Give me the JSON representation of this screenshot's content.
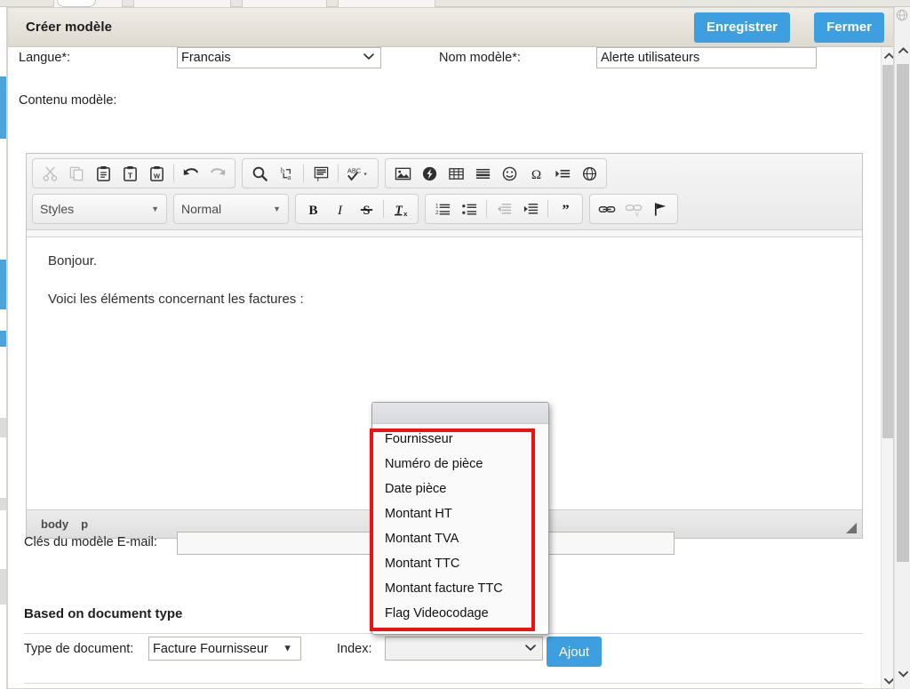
{
  "dialog": {
    "title": "Créer modèle",
    "save_label": "Enregistrer",
    "close_label": "Fermer"
  },
  "form": {
    "langue_label": "Langue*:",
    "langue_value": "Francais",
    "nom_modele_label": "Nom modèle*:",
    "nom_modele_value": "Alerte utilisateurs",
    "contenu_label": "Contenu modèle:",
    "cles_label": "Clés du modèle E-mail:",
    "cles_value": "",
    "section_title": "Based on document type",
    "type_document_label": "Type de document:",
    "type_document_value": "Facture Fournisseur",
    "index_label": "Index:",
    "index_value": "",
    "ajout_label": "Ajout"
  },
  "editor": {
    "styles_label": "Styles",
    "format_label": "Normal",
    "body_text": [
      "Bonjour.",
      "Voici les éléments concernant les factures :"
    ],
    "path": [
      "body",
      "p"
    ],
    "toolbar_row1": [
      {
        "icon": "cut-icon",
        "disabled": true
      },
      {
        "icon": "copy-icon",
        "disabled": true
      },
      {
        "icon": "paste-icon",
        "disabled": false
      },
      {
        "icon": "paste-as-plain-text-icon",
        "disabled": false
      },
      {
        "icon": "paste-from-word-icon",
        "disabled": false
      },
      {
        "icon": "separator",
        "disabled": false
      },
      {
        "icon": "undo-icon",
        "disabled": false
      },
      {
        "icon": "redo-icon",
        "disabled": true
      }
    ],
    "toolbar_row1b": [
      {
        "icon": "find-icon",
        "disabled": false
      },
      {
        "icon": "replace-icon",
        "disabled": false
      },
      {
        "icon": "separator",
        "disabled": false
      },
      {
        "icon": "select-all-icon",
        "disabled": false
      },
      {
        "icon": "separator",
        "disabled": false
      },
      {
        "icon": "spellcheck-icon",
        "disabled": false
      }
    ],
    "toolbar_row1c": [
      {
        "icon": "image-icon",
        "disabled": false
      },
      {
        "icon": "flash-icon",
        "disabled": false
      },
      {
        "icon": "table-icon",
        "disabled": false
      },
      {
        "icon": "horizontal-rule-icon",
        "disabled": false
      },
      {
        "icon": "smiley-icon",
        "disabled": false
      },
      {
        "icon": "special-character-icon",
        "disabled": false
      },
      {
        "icon": "page-break-icon",
        "disabled": false
      },
      {
        "icon": "iframe-icon",
        "disabled": false
      }
    ],
    "toolbar_row2a": [
      {
        "icon": "bold-icon",
        "disabled": false
      },
      {
        "icon": "italic-icon",
        "disabled": false
      },
      {
        "icon": "strikethrough-icon",
        "disabled": false
      },
      {
        "icon": "separator",
        "disabled": false
      },
      {
        "icon": "remove-format-icon",
        "disabled": false
      }
    ],
    "toolbar_row2b": [
      {
        "icon": "numbered-list-icon",
        "disabled": false
      },
      {
        "icon": "bulleted-list-icon",
        "disabled": false
      },
      {
        "icon": "separator",
        "disabled": false
      },
      {
        "icon": "outdent-icon",
        "disabled": true
      },
      {
        "icon": "indent-icon",
        "disabled": false
      },
      {
        "icon": "separator",
        "disabled": false
      },
      {
        "icon": "blockquote-icon",
        "disabled": false
      }
    ],
    "toolbar_row2c": [
      {
        "icon": "link-icon",
        "disabled": false
      },
      {
        "icon": "unlink-icon",
        "disabled": true
      },
      {
        "icon": "anchor-icon",
        "disabled": false
      }
    ]
  },
  "popup": {
    "items": [
      "Fournisseur",
      "Numéro de pièce",
      "Date pièce",
      "Montant HT",
      "Montant TVA",
      "Montant TTC",
      "Montant facture TTC",
      "Flag Videocodage"
    ]
  },
  "colors": {
    "accent_blue": "#3d9ee0",
    "annotation_red": "#ee1111",
    "header_grey": "#e6e2da"
  }
}
